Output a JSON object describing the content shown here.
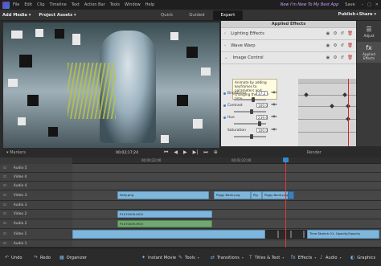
{
  "menu": {
    "items": [
      "File",
      "Edit",
      "Clip",
      "Timeline",
      "Text",
      "Action Bar",
      "Tools",
      "Window",
      "Help"
    ],
    "promo": "New I'm New To My Best App",
    "save": "Save"
  },
  "modebar": {
    "add_media": "Add Media",
    "project_assets": "Project Assets",
    "modes": [
      "Quick",
      "Guided",
      "Expert"
    ],
    "active_mode": "Expert",
    "publish": "Publish+Share"
  },
  "effects_panel": {
    "title": "Applied Effects",
    "rows": [
      {
        "label": "Lighting Effects"
      },
      {
        "label": "Wave Warp"
      },
      {
        "label": "Image Control"
      }
    ],
    "tooltip": "Animate by adding keyframes to parameters and changing them over time.",
    "params": [
      {
        "name": "Brightness",
        "value": "17.2"
      },
      {
        "name": "Contrast",
        "value": "100.0"
      },
      {
        "name": "Hue",
        "value": "239.6 °"
      },
      {
        "name": "Saturation",
        "value": "100.0"
      }
    ]
  },
  "right_tools": [
    {
      "label": "Adjust",
      "icon": "sliders-icon"
    },
    {
      "label": "Applied Effects",
      "icon": "fx-icon"
    }
  ],
  "transport": {
    "markers": "Markers",
    "timecode": "00;02;17;24",
    "render": "Render"
  },
  "timeline": {
    "ruler": [
      "00;00;22;00",
      "00;02;22;00"
    ],
    "tracks": [
      {
        "name": "Audio 5"
      },
      {
        "name": "Video 4"
      },
      {
        "name": "Audio 4"
      },
      {
        "name": "Video 3"
      },
      {
        "name": "Audio 3"
      },
      {
        "name": "Video 2"
      },
      {
        "name": "Audio 2"
      },
      {
        "name": "Video 1"
      },
      {
        "name": "Audio 1"
      }
    ],
    "clips": {
      "v3a": "Sally.png",
      "v3b": "Piggy Bank.png",
      "v3c": "Pig",
      "v3d": "Piggy Bank.png",
      "v2": "P1070009.MOV",
      "a2": "P1070009.MOV",
      "v1": "Time Stretch 01: Opacity/Opacity"
    }
  },
  "actionbar": {
    "undo": "Undo",
    "redo": "Redo",
    "organizer": "Organizer",
    "instant_movie": "Instant Movie",
    "tools": "Tools",
    "transitions": "Transitions",
    "titles": "Titles & Text",
    "effects": "Effects",
    "audio": "Audio",
    "graphics": "Graphics"
  }
}
